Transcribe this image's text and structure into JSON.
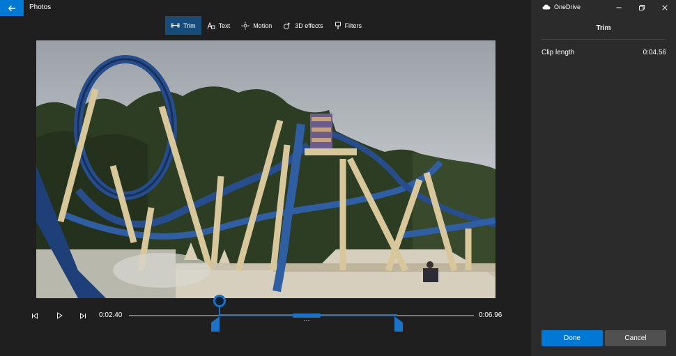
{
  "app": {
    "title": "Photos"
  },
  "toolbar": {
    "tools": [
      {
        "label": "Trim",
        "icon": "trim-icon",
        "active": true
      },
      {
        "label": "Text",
        "icon": "text-icon",
        "active": false
      },
      {
        "label": "Motion",
        "icon": "motion-icon",
        "active": false
      },
      {
        "label": "3D effects",
        "icon": "3d-effects-icon",
        "active": false
      },
      {
        "label": "Filters",
        "icon": "filters-icon",
        "active": false
      }
    ]
  },
  "playback": {
    "start_time": "0:02.40",
    "end_time": "0:06.96"
  },
  "panel": {
    "onedrive_label": "OneDrive",
    "title": "Trim",
    "clip_length_label": "Clip length",
    "clip_length_value": "0:04.56",
    "done_label": "Done",
    "cancel_label": "Cancel"
  },
  "colors": {
    "accent": "#0078d4",
    "selection": "#1a73c8",
    "active_tool_bg": "#174c7a",
    "background": "#1f1f1f",
    "panel_bg": "#2b2b2b"
  }
}
